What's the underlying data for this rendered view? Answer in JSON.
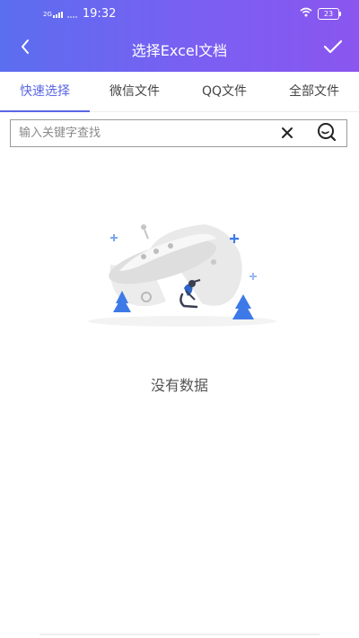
{
  "status_bar": {
    "network_badge": "2G",
    "time": "19:32",
    "battery": "23"
  },
  "nav": {
    "title": "选择Excel文档"
  },
  "tabs": [
    {
      "label": "快速选择",
      "active": true
    },
    {
      "label": "微信文件",
      "active": false
    },
    {
      "label": "QQ文件",
      "active": false
    },
    {
      "label": "全部文件",
      "active": false
    }
  ],
  "search": {
    "value": "",
    "placeholder": "输入关键字查找"
  },
  "empty_state": {
    "message": "没有数据"
  },
  "colors": {
    "header_gradient_start": "#5b6ef0",
    "header_gradient_end": "#8a56f0",
    "tab_active": "#5a66e6",
    "illustration_blue": "#3d7ae8"
  },
  "icons": {
    "back": "chevron-left-icon",
    "confirm": "checkmark-icon",
    "clear": "close-icon",
    "search": "search-icon",
    "wifi": "wifi-icon",
    "battery": "battery-icon"
  }
}
